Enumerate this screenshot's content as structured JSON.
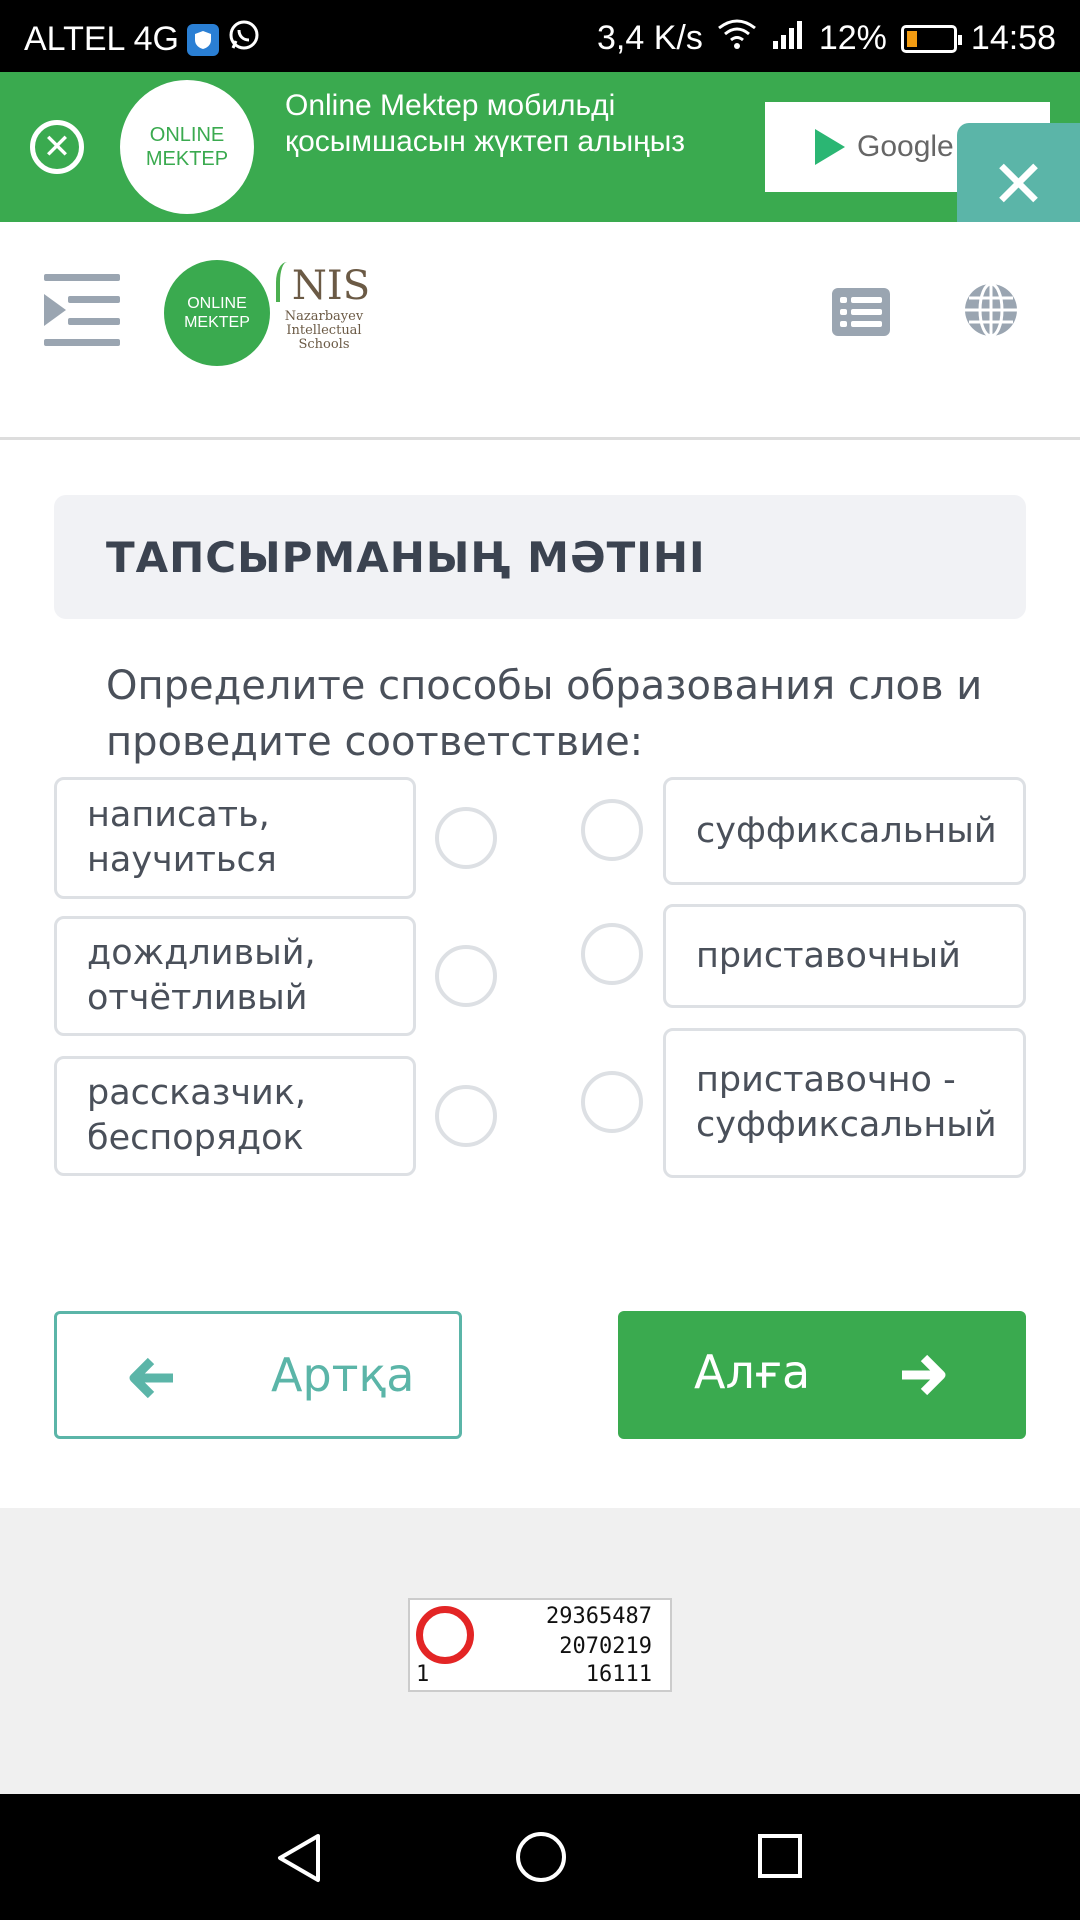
{
  "status_bar": {
    "carrier": "ALTEL 4G",
    "speed": "3,4 K/s",
    "battery": "12%",
    "time": "14:58"
  },
  "promo": {
    "logo_line1": "ONLINE",
    "logo_line2": "MEKTEP",
    "text": "Online Mektep мобильді қосымшасын жүктеп алыңыз",
    "store_label": "Google P"
  },
  "header": {
    "logo_line1": "ONLINE",
    "logo_line2": "MEKTEP",
    "nis_title": "NIS",
    "nis_line1": "Nazarbayev",
    "nis_line2": "Intellectual",
    "nis_line3": "Schools"
  },
  "task": {
    "header": "ТАПСЫРМАНЫҢ МӘТІНІ",
    "question": "Определите способы образования слов и проведите соответствие:",
    "left_items": [
      {
        "label": "написать, научиться"
      },
      {
        "label": "дождливый, отчётливый"
      },
      {
        "label": "рассказчик, беспорядок"
      }
    ],
    "right_items": [
      {
        "label": "суффиксальный"
      },
      {
        "label": "приставочный"
      },
      {
        "label": "приставочно - суффиксальный"
      }
    ]
  },
  "nav": {
    "back_label": "Артқа",
    "next_label": "Алға"
  },
  "counter": {
    "line1": "29365487",
    "line2": "2070219",
    "line3": "16111",
    "line4": "1"
  },
  "colors": {
    "brand_green": "#3aaa4f",
    "teal": "#5bb5a8",
    "counter_red": "#e32525"
  },
  "icons": [
    "shield-icon",
    "whatsapp-icon",
    "wifi-icon",
    "signal-icon",
    "battery-icon",
    "close-circle-icon",
    "close-icon",
    "menu-icon",
    "list-icon",
    "globe-icon",
    "arrow-left-icon",
    "arrow-right-icon",
    "back-triangle-icon",
    "home-circle-icon",
    "recents-square-icon"
  ]
}
